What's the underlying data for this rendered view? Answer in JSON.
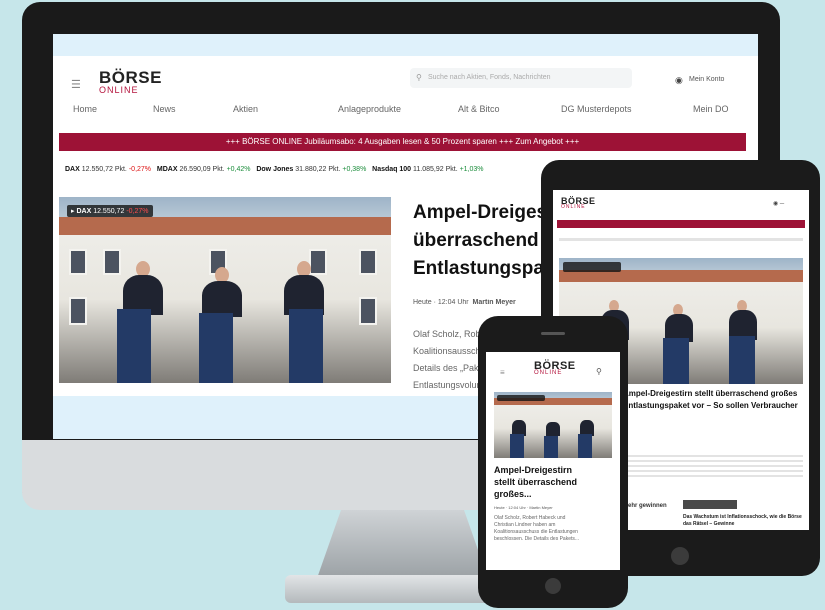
{
  "desktop": {
    "logo_top": "BÖRSE",
    "logo_bottom": "ONLINE",
    "search_placeholder": "Suche nach Aktien, Fonds, Nachrichten",
    "account_label": "Mein Konto",
    "nav": [
      "Home",
      "News",
      "Aktien",
      "Anlageprodukte",
      "Alt & Bitco",
      "DG Musterdepots",
      "Mein DO"
    ],
    "banner": "+++ BÖRSE ONLINE Jubiläumsabo: 4 Ausgaben lesen & 50 Prozent sparen +++ Zum Angebot +++",
    "ticker": [
      {
        "name": "DAX",
        "value": "12.550,72 Pkt.",
        "change": "-0,27%",
        "dir": "neg"
      },
      {
        "name": "MDAX",
        "value": "26.590,09 Pkt.",
        "change": "+0,42%",
        "dir": "pos"
      },
      {
        "name": "Dow Jones",
        "value": "31.880,22 Pkt.",
        "change": "+0,38%",
        "dir": "pos"
      },
      {
        "name": "Nasdaq 100",
        "value": "11.085,92 Pkt.",
        "change": "+1,03%",
        "dir": "pos"
      }
    ],
    "hero_badge_name": "DAX",
    "hero_badge_value": "12.550,72",
    "hero_badge_change": "-0,27%",
    "headline_lines": [
      "Ampel-Dreigestirn stellt",
      "überraschend großes",
      "Entlastungspaket vor"
    ],
    "meta_date": "Heute · 12:04 Uhr",
    "meta_author": "Martin Meyer",
    "body_lines": [
      "Olaf Scholz, Robert Habeck und Christian Lindner haben am",
      "Koalitionsausschuss die Entlastungen beschlossen. Die",
      "Details des „Pakets“ kosten den Staat Milliarden. Das",
      "Entlastungsvolumen beträgt 65 Milliarden Euro."
    ]
  },
  "tablet": {
    "logo_top": "BÖRSE",
    "logo_bottom": "ONLINE",
    "headline_lines": [
      "Ampel-Dreigestirn stellt überraschend großes",
      "Entlastungspaket vor – So sollen Verbraucher"
    ],
    "teaser": "Das Wachstum ist Inflationsschock, wie die Börse das Rätsel – Gewinne",
    "cta": "Mehr gewinnen"
  },
  "phone": {
    "logo_top": "BÖRSE",
    "logo_bottom": "ONLINE",
    "headline_lines": [
      "Ampel-Dreigestirn",
      "stellt überraschend",
      "großes..."
    ],
    "meta": "Heute · 12:04 Uhr · Martin Meyer",
    "body_lines": [
      "Olaf Scholz, Robert Habeck und",
      "Christian Lindner haben am",
      "Koalitionsausschuss die Entlastungen",
      "beschlossen. Die Details des Pakets..."
    ]
  }
}
